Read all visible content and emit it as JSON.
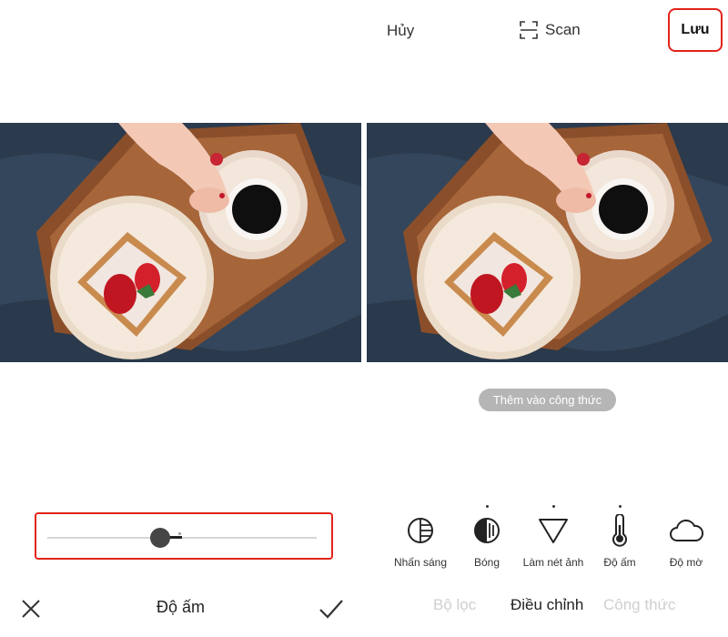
{
  "left_panel": {
    "tool_name": "Độ ấm",
    "slider": {
      "value_fraction": 0.42
    }
  },
  "right_panel": {
    "topbar": {
      "cancel_label": "Hủy",
      "scan_label": "Scan",
      "save_label": "Lưu"
    },
    "add_to_recipe_label": "Thêm vào công thức",
    "tools": [
      {
        "label": "Nhấn sáng",
        "icon": "highlight-icon",
        "modified": false
      },
      {
        "label": "Bóng",
        "icon": "shadow-icon",
        "modified": true
      },
      {
        "label": "Làm nét ảnh",
        "icon": "sharpen-icon",
        "modified": true
      },
      {
        "label": "Độ ấm",
        "icon": "thermometer-icon",
        "modified": true
      },
      {
        "label": "Độ mờ",
        "icon": "cloud-icon",
        "modified": false
      }
    ],
    "tabs": [
      {
        "label": "Bộ lọc",
        "active": false
      },
      {
        "label": "Điều chỉnh",
        "active": true
      },
      {
        "label": "Công thức",
        "active": false
      }
    ]
  },
  "colors": {
    "highlight_red": "#e2231a",
    "inactive_text": "#cfcfcf",
    "pill_gray": "#b5b5b5"
  }
}
